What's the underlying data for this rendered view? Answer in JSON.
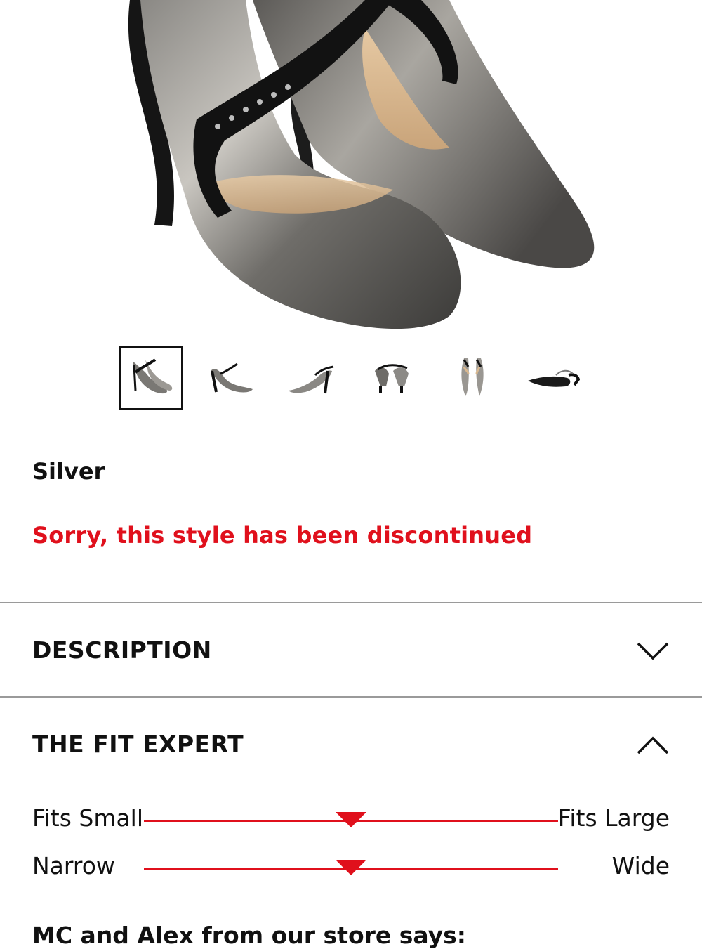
{
  "product": {
    "color_label": "Silver",
    "status_message": "Sorry, this style has been discontinued",
    "status_color": "#e0101c",
    "thumbnails": [
      {
        "name": "front-pair-view",
        "selected": true
      },
      {
        "name": "side-view",
        "selected": false
      },
      {
        "name": "inner-side-view",
        "selected": false
      },
      {
        "name": "rear-pair-view",
        "selected": false
      },
      {
        "name": "top-view",
        "selected": false
      },
      {
        "name": "sole-view",
        "selected": false
      }
    ]
  },
  "sections": {
    "description": {
      "title": "DESCRIPTION",
      "icon": "chevron-down-icon",
      "expanded": false
    },
    "fit_expert": {
      "title": "THE FIT EXPERT",
      "icon": "chevron-up-icon",
      "expanded": true,
      "scales": [
        {
          "left_label": "Fits Small",
          "right_label": "Fits Large",
          "level": 0.5
        },
        {
          "left_label": "Narrow",
          "right_label": "Wide",
          "level": 0.5
        }
      ]
    },
    "store_says": {
      "title": "MC and Alex from our store says:"
    }
  }
}
